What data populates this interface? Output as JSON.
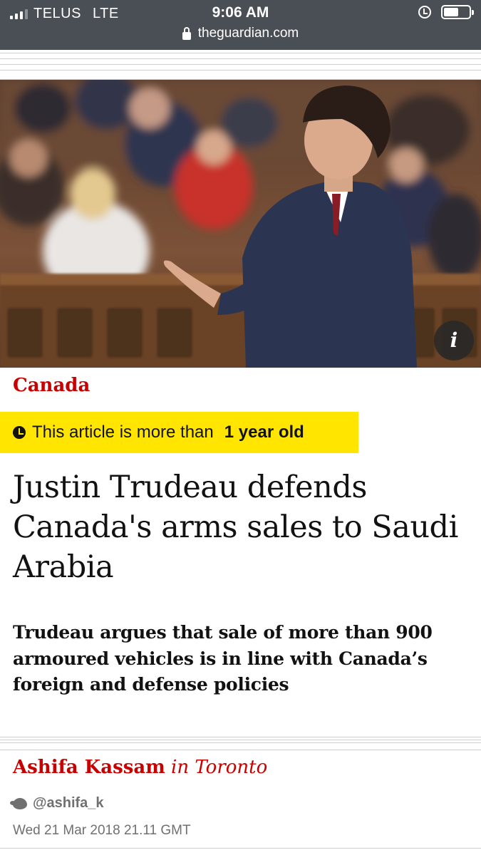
{
  "status_bar": {
    "carrier": "TELUS",
    "network": "LTE",
    "time": "9:06 AM",
    "url": "theguardian.com",
    "icons": [
      "signal-icon",
      "lock-icon",
      "alarm-icon",
      "battery-icon"
    ]
  },
  "hero": {
    "info_label": "i",
    "icon": "info-icon"
  },
  "article": {
    "section": "Canada",
    "age_notice_prefix": "This article is more than",
    "age_notice_bold": "1 year old",
    "headline": "Justin Trudeau defends Canada's arms sales to Saudi Arabia",
    "standfirst": "Trudeau argues that sale of more than 900 armoured vehicles is in line with Canada’s foreign and defense policies",
    "author": "Ashifa Kassam",
    "location": "in Toronto",
    "twitter_handle": "@ashifa_k",
    "date": "Wed 21 Mar 2018 21.11 GMT"
  },
  "colors": {
    "status_bar_bg": "#4a4e55",
    "accent_red": "#c70000",
    "age_badge_yellow": "#ffe500",
    "text": "#121212",
    "meta_grey": "#707070"
  }
}
